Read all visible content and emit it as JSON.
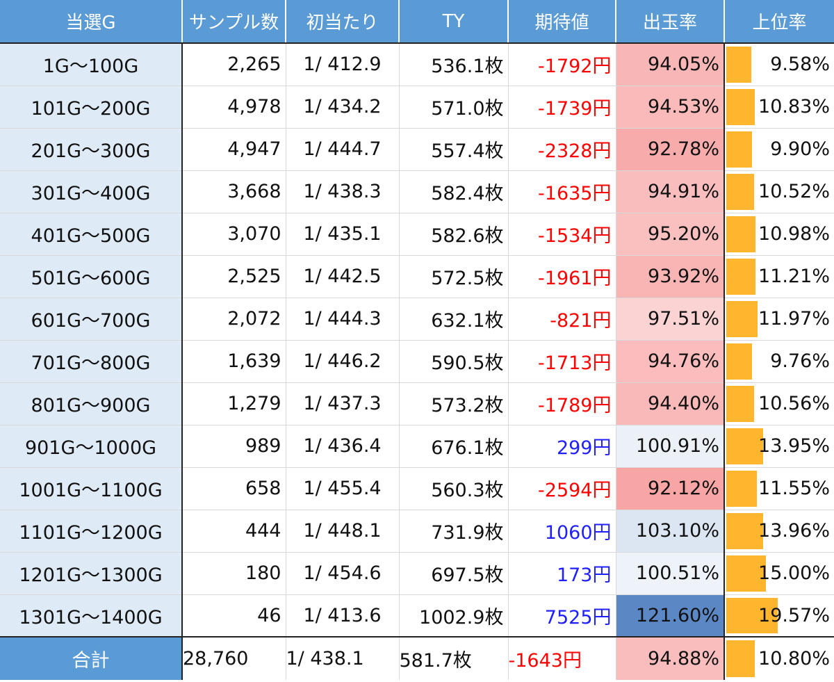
{
  "headers": [
    "当選G",
    "サンプル数",
    "初当たり",
    "TY",
    "期待値",
    "出玉率",
    "上位率"
  ],
  "rows": [
    {
      "label": "1G〜100G",
      "samples": "2,265",
      "first_hit": "1/ 412.9",
      "ty": "536.1枚",
      "ev": "-1792円",
      "ev_value": -1792,
      "payout": "94.05%",
      "payout_value": 94.05,
      "top_rate": "9.58%",
      "top_rate_value": 9.58
    },
    {
      "label": "101G〜200G",
      "samples": "4,978",
      "first_hit": "1/ 434.2",
      "ty": "571.0枚",
      "ev": "-1739円",
      "ev_value": -1739,
      "payout": "94.53%",
      "payout_value": 94.53,
      "top_rate": "10.83%",
      "top_rate_value": 10.83
    },
    {
      "label": "201G〜300G",
      "samples": "4,947",
      "first_hit": "1/ 444.7",
      "ty": "557.4枚",
      "ev": "-2328円",
      "ev_value": -2328,
      "payout": "92.78%",
      "payout_value": 92.78,
      "top_rate": "9.90%",
      "top_rate_value": 9.9
    },
    {
      "label": "301G〜400G",
      "samples": "3,668",
      "first_hit": "1/ 438.3",
      "ty": "582.4枚",
      "ev": "-1635円",
      "ev_value": -1635,
      "payout": "94.91%",
      "payout_value": 94.91,
      "top_rate": "10.52%",
      "top_rate_value": 10.52
    },
    {
      "label": "401G〜500G",
      "samples": "3,070",
      "first_hit": "1/ 435.1",
      "ty": "582.6枚",
      "ev": "-1534円",
      "ev_value": -1534,
      "payout": "95.20%",
      "payout_value": 95.2,
      "top_rate": "10.98%",
      "top_rate_value": 10.98
    },
    {
      "label": "501G〜600G",
      "samples": "2,525",
      "first_hit": "1/ 442.5",
      "ty": "572.5枚",
      "ev": "-1961円",
      "ev_value": -1961,
      "payout": "93.92%",
      "payout_value": 93.92,
      "top_rate": "11.21%",
      "top_rate_value": 11.21
    },
    {
      "label": "601G〜700G",
      "samples": "2,072",
      "first_hit": "1/ 444.3",
      "ty": "632.1枚",
      "ev": "-821円",
      "ev_value": -821,
      "payout": "97.51%",
      "payout_value": 97.51,
      "top_rate": "11.97%",
      "top_rate_value": 11.97
    },
    {
      "label": "701G〜800G",
      "samples": "1,639",
      "first_hit": "1/ 446.2",
      "ty": "590.5枚",
      "ev": "-1713円",
      "ev_value": -1713,
      "payout": "94.76%",
      "payout_value": 94.76,
      "top_rate": "9.76%",
      "top_rate_value": 9.76
    },
    {
      "label": "801G〜900G",
      "samples": "1,279",
      "first_hit": "1/ 437.3",
      "ty": "573.2枚",
      "ev": "-1789円",
      "ev_value": -1789,
      "payout": "94.40%",
      "payout_value": 94.4,
      "top_rate": "10.56%",
      "top_rate_value": 10.56
    },
    {
      "label": "901G〜1000G",
      "samples": "989",
      "first_hit": "1/ 436.4",
      "ty": "676.1枚",
      "ev": "299円",
      "ev_value": 299,
      "payout": "100.91%",
      "payout_value": 100.91,
      "top_rate": "13.95%",
      "top_rate_value": 13.95
    },
    {
      "label": "1001G〜1100G",
      "samples": "658",
      "first_hit": "1/ 455.4",
      "ty": "560.3枚",
      "ev": "-2594円",
      "ev_value": -2594,
      "payout": "92.12%",
      "payout_value": 92.12,
      "top_rate": "11.55%",
      "top_rate_value": 11.55
    },
    {
      "label": "1101G〜1200G",
      "samples": "444",
      "first_hit": "1/ 448.1",
      "ty": "731.9枚",
      "ev": "1060円",
      "ev_value": 1060,
      "payout": "103.10%",
      "payout_value": 103.1,
      "top_rate": "13.96%",
      "top_rate_value": 13.96
    },
    {
      "label": "1201G〜1300G",
      "samples": "180",
      "first_hit": "1/ 454.6",
      "ty": "697.5枚",
      "ev": "173円",
      "ev_value": 173,
      "payout": "100.51%",
      "payout_value": 100.51,
      "top_rate": "15.00%",
      "top_rate_value": 15.0
    },
    {
      "label": "1301G〜1400G",
      "samples": "46",
      "first_hit": "1/ 413.6",
      "ty": "1002.9枚",
      "ev": "7525円",
      "ev_value": 7525,
      "payout": "121.60%",
      "payout_value": 121.6,
      "top_rate": "19.57%",
      "top_rate_value": 19.57
    }
  ],
  "total": {
    "label": "合計",
    "samples": "28,760",
    "first_hit": "1/ 438.1",
    "ty": "581.7枚",
    "ev": "-1643円",
    "ev_value": -1643,
    "payout": "94.88%",
    "payout_value": 94.88,
    "top_rate": "10.80%",
    "top_rate_value": 10.8
  },
  "colors": {
    "header_bg": "#5b9bd5",
    "label_bg": "#deebf7",
    "negative_text": "#ff0000",
    "positive_text": "#1f1fff",
    "payout_low": "#f8a5a5",
    "payout_neutral": "#ffffff",
    "payout_high": "#5b87c4",
    "top_rate_bar": "#ffb62e"
  }
}
